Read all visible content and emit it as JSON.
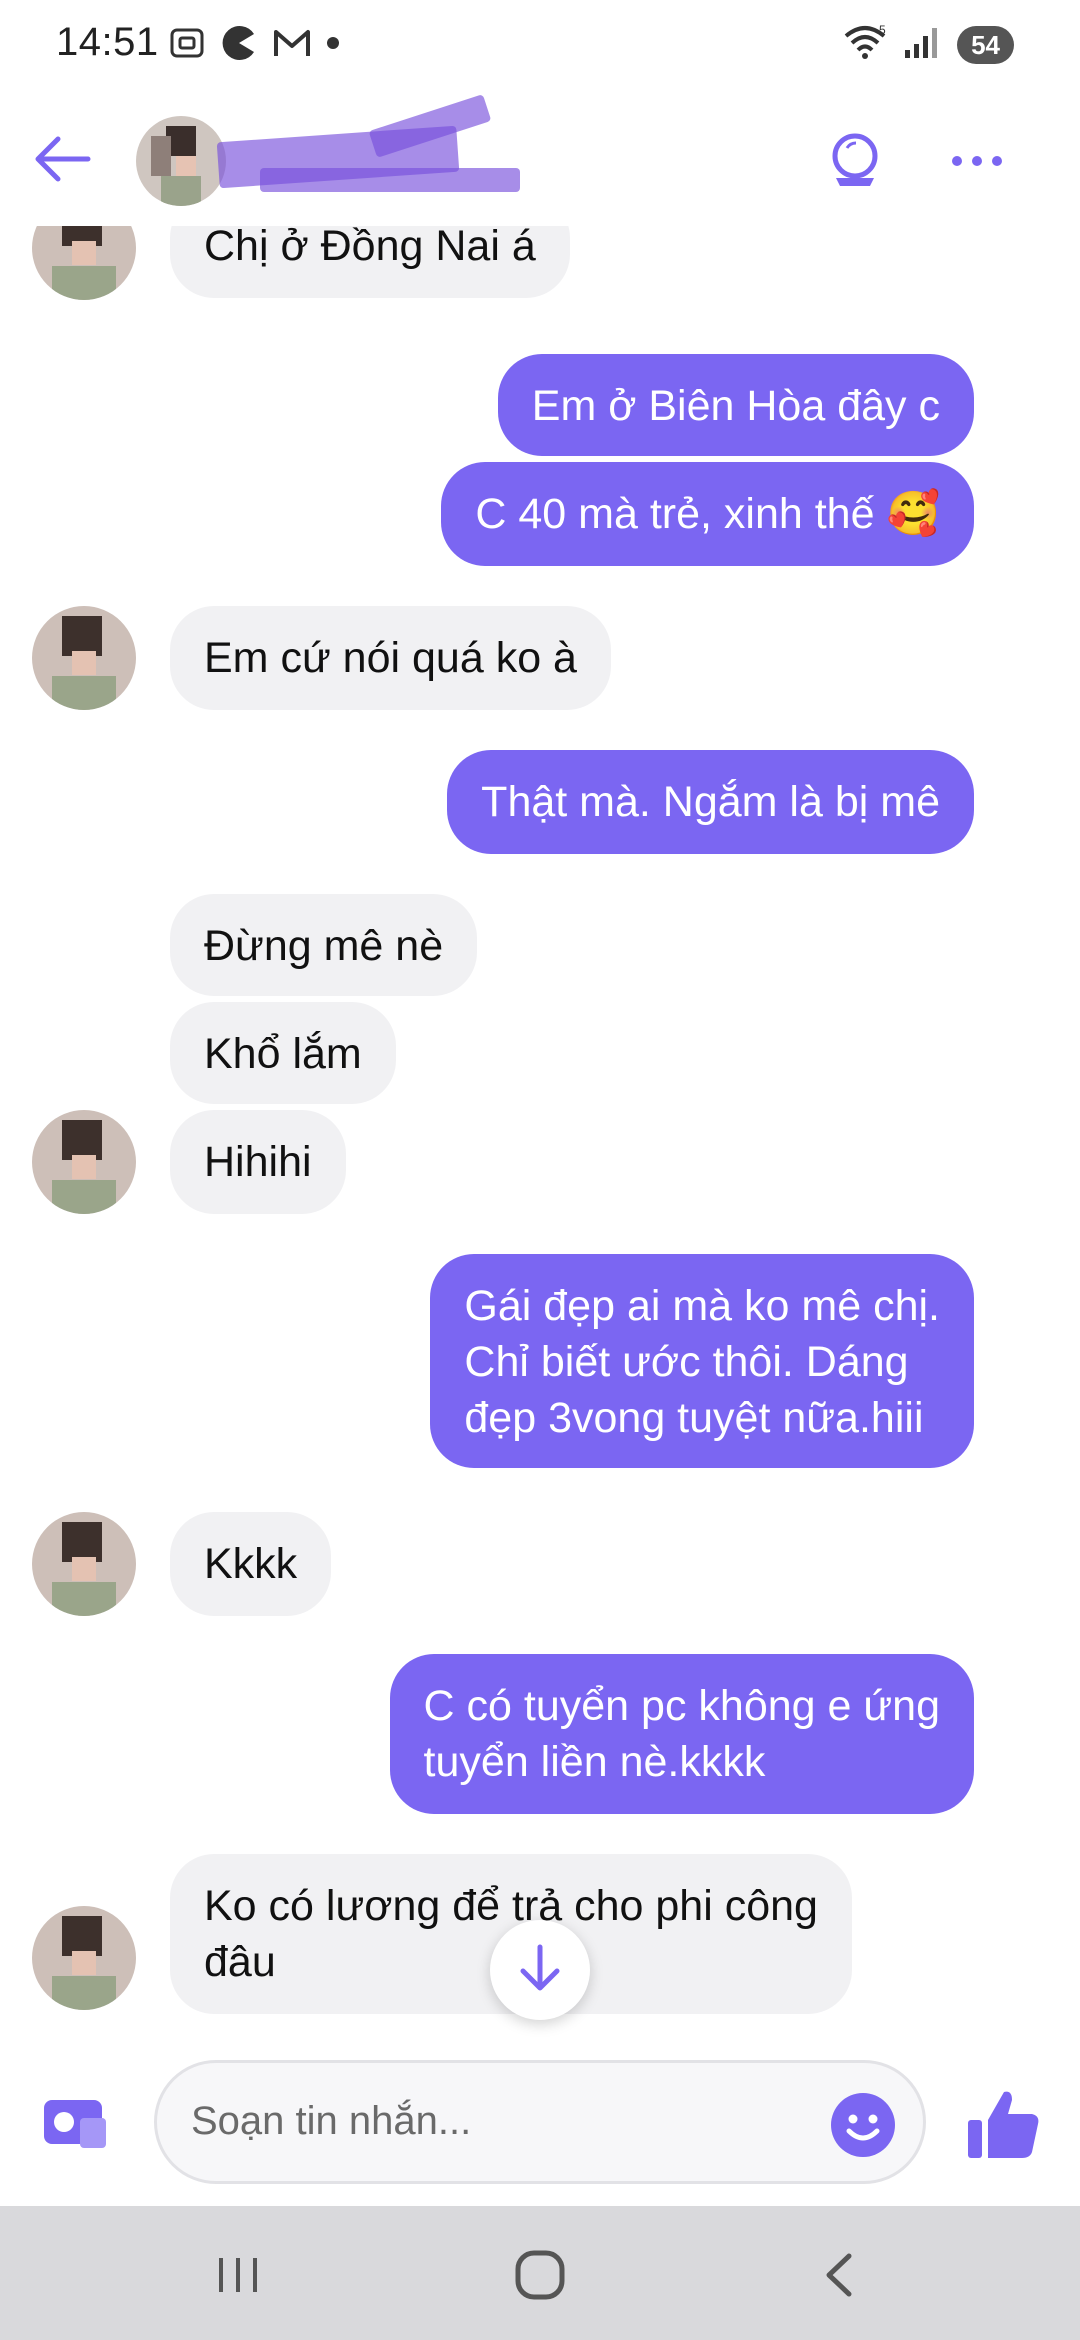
{
  "status_bar": {
    "time": "14:51",
    "battery": "54",
    "icons_left": [
      "screenshot-icon",
      "pacman-app-icon",
      "gmail-icon",
      "dot-icon"
    ],
    "icons_right": [
      "wifi-icon",
      "signal-icon",
      "battery-icon"
    ]
  },
  "header": {
    "contact_name": "",
    "actions": [
      "back-arrow-icon",
      "orb-icon",
      "more-icon"
    ]
  },
  "colors": {
    "accent": "#7b66f2",
    "incoming_bubble": "#f1f1f3",
    "outgoing_bubble": "#7b66f2"
  },
  "messages": [
    {
      "direction": "in",
      "text": "Chị ở Đồng Nai á"
    },
    {
      "direction": "out",
      "text": "Em ở Biên Hòa đây c"
    },
    {
      "direction": "out",
      "text": "C 40 mà trẻ, xinh thế 🥰"
    },
    {
      "direction": "in",
      "text": "Em cứ nói quá ko à"
    },
    {
      "direction": "out",
      "text": "Thật mà. Ngắm là bị mê"
    },
    {
      "direction": "in",
      "text": "Đừng mê nè"
    },
    {
      "direction": "in",
      "text": "Khổ lắm"
    },
    {
      "direction": "in",
      "text": "Hihihi"
    },
    {
      "direction": "out",
      "text": "Gái đẹp ai mà ko mê chị.\nChỉ biết ước thôi. Dáng\nđẹp 3vong tuyệt nữa.hiii"
    },
    {
      "direction": "in",
      "text": "Kkkk"
    },
    {
      "direction": "out",
      "text": "C có tuyển pc không e ứng\ntuyển liền nè.kkkk"
    },
    {
      "direction": "in",
      "text": "Ko có lương để trả cho phi công\nđâu"
    }
  ],
  "composer": {
    "placeholder": "Soạn tin nhắn...",
    "icons": [
      "camera-icon",
      "emoji-icon",
      "thumbs-up-icon"
    ]
  },
  "nav_bar": {
    "buttons": [
      "recents-icon",
      "home-icon",
      "back-icon"
    ]
  }
}
